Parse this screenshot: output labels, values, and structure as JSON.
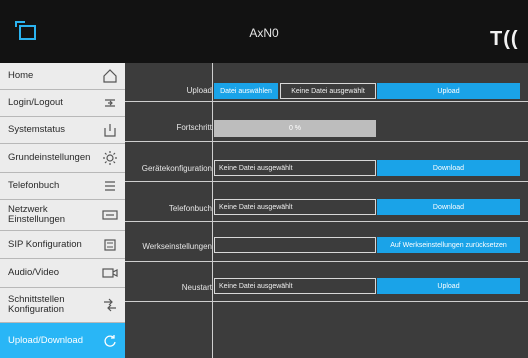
{
  "header": {
    "title": "AxN0",
    "logo_text": "T(("
  },
  "sidebar": {
    "items": [
      {
        "label": "Home",
        "icon": "home-icon"
      },
      {
        "label": "Login/Logout",
        "icon": "login-icon"
      },
      {
        "label": "Systemstatus",
        "icon": "status-icon"
      },
      {
        "label": "Grundeinstellungen",
        "icon": "gear-icon"
      },
      {
        "label": "Telefonbuch",
        "icon": "list-icon"
      },
      {
        "label": "Netzwerk Einstellungen",
        "icon": "network-icon"
      },
      {
        "label": "SIP Konfiguration",
        "icon": "sip-icon"
      },
      {
        "label": "Audio/Video",
        "icon": "camera-icon"
      },
      {
        "label": "Schnittstellen Konfiguration",
        "icon": "interface-icon"
      },
      {
        "label": "Upload/Download",
        "icon": "refresh-icon"
      }
    ],
    "active_index": 9
  },
  "main": {
    "upload": {
      "label": "Upload",
      "choose_label": "Datei auswählen",
      "file_status": "Keine Datei ausgewählt",
      "button": "Upload"
    },
    "progress": {
      "label": "Fortschritt",
      "text": "0 %",
      "value": 0
    },
    "device_config": {
      "label": "Gerätekonfiguration",
      "field": "Keine Datei ausgewählt",
      "button": "Download"
    },
    "phonebook": {
      "label": "Telefonbuch",
      "field": "Keine Datei ausgewählt",
      "button": "Download"
    },
    "factory": {
      "label": "Werkseinstellungen",
      "field": "",
      "button": "Auf Werkseinstellungen zurücksetzen"
    },
    "restart": {
      "label": "Neustart",
      "field": "Keine Datei ausgewählt",
      "button": "Upload"
    }
  },
  "colors": {
    "accent": "#1aa3e8",
    "active_nav": "#29b6f6",
    "header_bg": "#121212",
    "main_bg": "#3c3c3c",
    "sidebar_bg": "#ececec"
  }
}
